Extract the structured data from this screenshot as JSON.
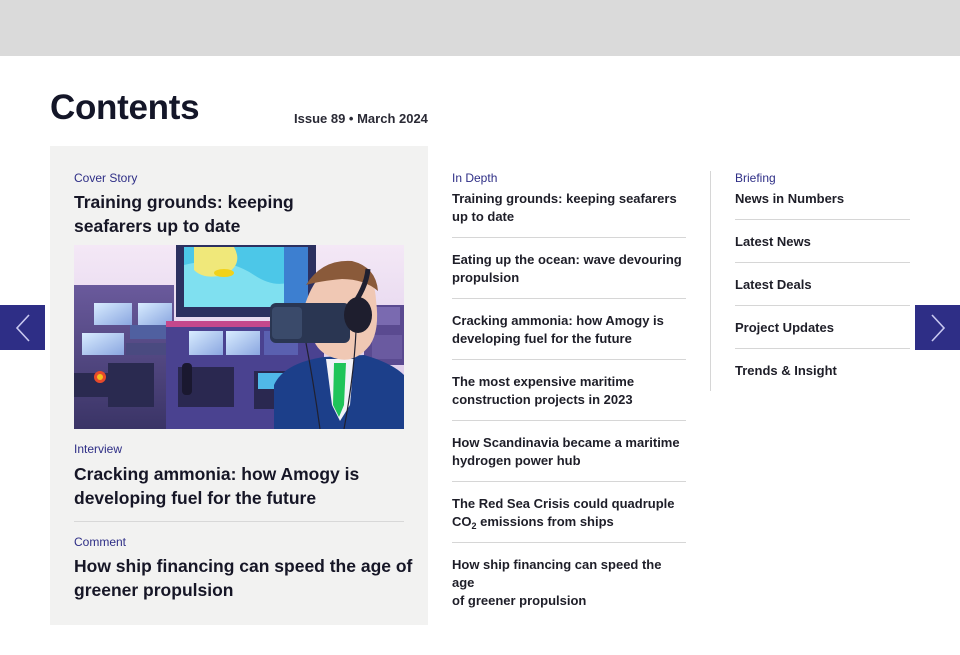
{
  "page": {
    "title": "Contents",
    "issue": "Issue 89 • March 2024"
  },
  "feature": {
    "cover": {
      "category": "Cover Story",
      "title_line1": "Training grounds: keeping",
      "title_line2": "seafarers up to date",
      "image_alt": "Man wearing VR headset at ship bridge simulator"
    },
    "interview": {
      "category": "Interview",
      "title_line1": "Cracking ammonia: how Amogy is",
      "title_line2": "developing fuel for the future"
    },
    "comment": {
      "category": "Comment",
      "title_line1": "How ship financing can speed the age of",
      "title_line2": "greener propulsion"
    }
  },
  "in_depth": {
    "category": "In Depth",
    "items": [
      {
        "line1": "Training grounds: keeping seafarers",
        "line2": "up to date"
      },
      {
        "line1": "Eating up the ocean: wave devouring",
        "line2": "propulsion"
      },
      {
        "line1": "Cracking ammonia: how Amogy is",
        "line2": "developing fuel for the future"
      },
      {
        "line1": "The most expensive maritime",
        "line2": "construction projects in 2023"
      },
      {
        "line1": "How Scandinavia became a maritime",
        "line2": "hydrogen power hub"
      },
      {
        "line1": "The Red Sea Crisis could quadruple",
        "line2_pre": "CO",
        "line2_sub": "2",
        "line2_post": " emissions from ships"
      },
      {
        "line1": "How ship financing can speed the age",
        "line2": "of greener propulsion"
      }
    ]
  },
  "briefing": {
    "category": "Briefing",
    "items": [
      "News in Numbers",
      "Latest News",
      "Latest Deals",
      "Project Updates",
      "Trends & Insight"
    ]
  },
  "nav": {
    "prev_icon": "chevron-left-icon",
    "next_icon": "chevron-right-icon"
  },
  "colors": {
    "accent": "#2e2e86",
    "feature_bg": "#f2f2f1",
    "topbar_bg": "#dadada"
  }
}
